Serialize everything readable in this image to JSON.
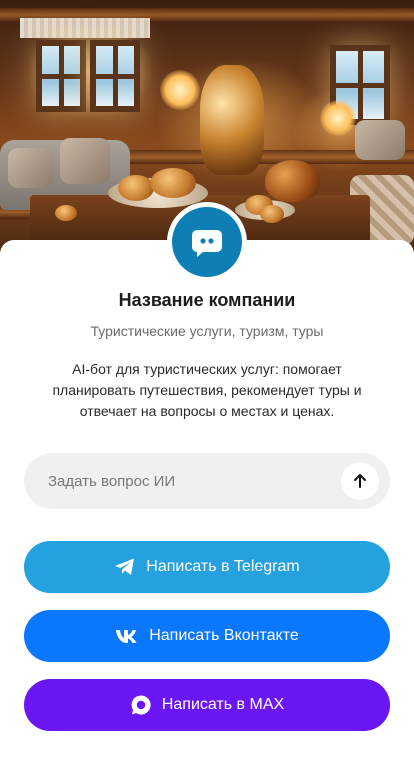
{
  "profile": {
    "company_name": "Название компании",
    "tagline": "Туристические услуги, туризм, туры",
    "description": "AI-бот для туристических услуг: помогает планировать путешествия, рекомендует туры и отвечает на вопросы о местах и ценах.",
    "avatar_icon": "chat-bubble-icon",
    "avatar_color": "#0e7fb4"
  },
  "ask": {
    "placeholder": "Задать вопрос ИИ",
    "send_icon": "arrow-up-icon"
  },
  "actions": [
    {
      "label": "Написать в Telegram",
      "icon": "telegram-icon",
      "color": "#24a1de"
    },
    {
      "label": "Написать Вконтакте",
      "icon": "vk-icon",
      "color": "#0a77ff"
    },
    {
      "label": "Написать в MAX",
      "icon": "max-icon",
      "color": "#6b16f5"
    }
  ]
}
